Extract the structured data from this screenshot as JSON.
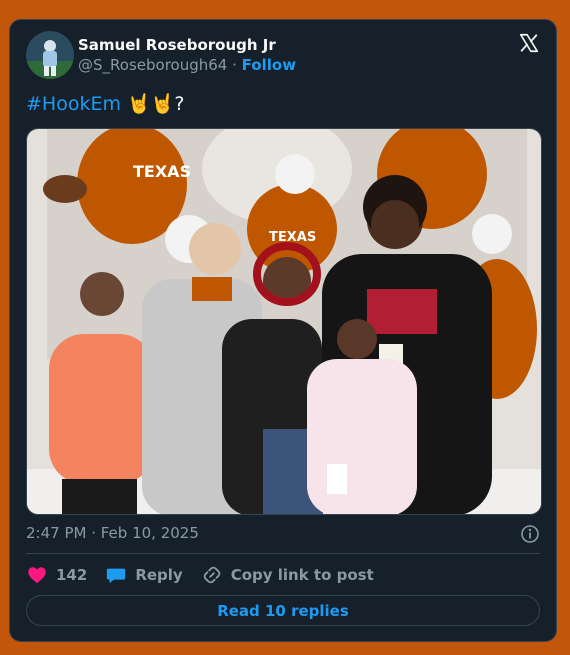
{
  "author": {
    "name": "Samuel Roseborough Jr",
    "handle": "@S_Roseborough64",
    "separator": "·",
    "follow_label": "Follow"
  },
  "tweet": {
    "hashtag": "#HookEm",
    "emoji": "🤘🤘?",
    "timestamp": "2:47 PM · Feb 10, 2025"
  },
  "actions": {
    "likes": "142",
    "reply_label": "Reply",
    "copy_label": "Copy link to post",
    "read_replies_label": "Read 10 replies"
  },
  "photo": {
    "banner_text": "TEXAS",
    "jersey_text": "TEXAS"
  },
  "colors": {
    "accent": "#1d9bf0",
    "like": "#f91880",
    "card_bg": "#15202b",
    "page_bg": "#c2570c",
    "burnt_orange": "#bf5700"
  },
  "icons": {
    "close": "x-logo-icon",
    "info": "info-icon",
    "like": "heart-icon",
    "reply": "speech-bubble-icon",
    "copy": "link-icon"
  }
}
